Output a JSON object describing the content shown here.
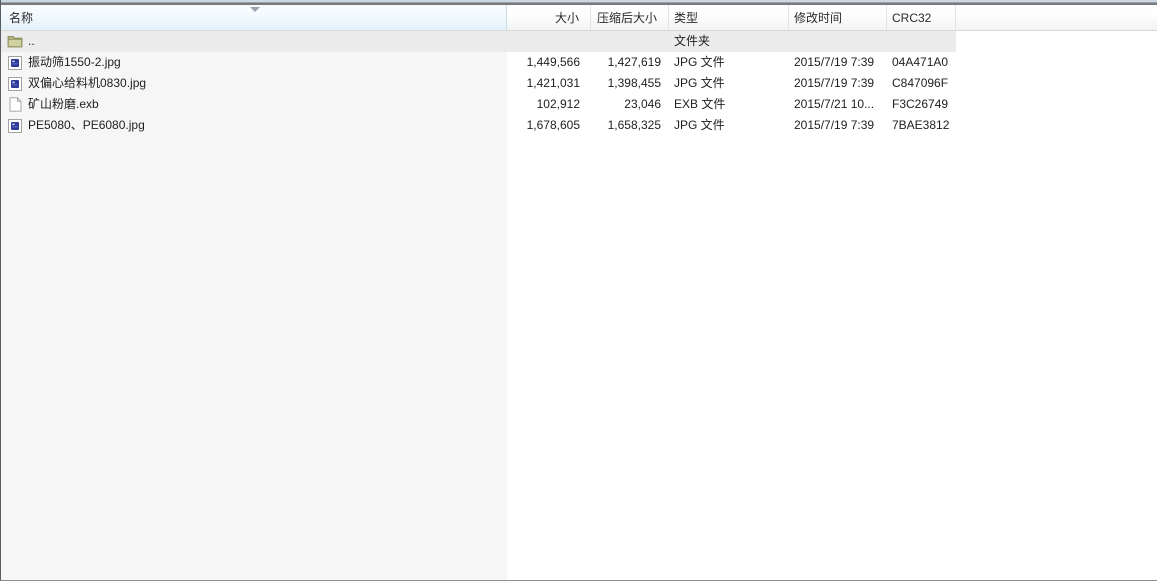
{
  "window": {
    "view": "archive-file-list"
  },
  "columns": [
    {
      "key": "name",
      "label": "名称",
      "align": "left",
      "sorted": true,
      "sort_direction": "desc"
    },
    {
      "key": "size",
      "label": "大小",
      "align": "right"
    },
    {
      "key": "packed",
      "label": "压缩后大小",
      "align": "right"
    },
    {
      "key": "type",
      "label": "类型",
      "align": "left"
    },
    {
      "key": "modified",
      "label": "修改时间",
      "align": "left"
    },
    {
      "key": "crc32",
      "label": "CRC32",
      "align": "left"
    }
  ],
  "rows": [
    {
      "icon": "folder-up-icon",
      "name": "..",
      "size": "",
      "packed": "",
      "type": "文件夹",
      "modified": "",
      "crc32": "",
      "is_parent": true
    },
    {
      "icon": "image-file-icon",
      "name": "振动筛1550-2.jpg",
      "size": "1,449,566",
      "packed": "1,427,619",
      "type": "JPG 文件",
      "modified": "2015/7/19 7:39",
      "crc32": "04A471A0",
      "is_parent": false
    },
    {
      "icon": "image-file-icon",
      "name": "双偏心给料机0830.jpg",
      "size": "1,421,031",
      "packed": "1,398,455",
      "type": "JPG 文件",
      "modified": "2015/7/19 7:39",
      "crc32": "C847096F",
      "is_parent": false
    },
    {
      "icon": "document-file-icon",
      "name": "矿山粉磨.exb",
      "size": "102,912",
      "packed": "23,046",
      "type": "EXB 文件",
      "modified": "2015/7/21 10...",
      "crc32": "F3C26749",
      "is_parent": false
    },
    {
      "icon": "image-file-icon",
      "name": "PE5080、PE6080.jpg",
      "size": "1,678,605",
      "packed": "1,658,325",
      "type": "JPG 文件",
      "modified": "2015/7/19 7:39",
      "crc32": "7BAE3812",
      "is_parent": false
    }
  ],
  "colors": {
    "sorted_header_bg": "#e2f1f9",
    "parent_row_bg": "#ececec",
    "left_pane_bg": "#f6f6f6",
    "folder_icon": "#c7ca92",
    "image_icon_inner": "#2e3a96",
    "top_edge_dark": "#77797c"
  }
}
